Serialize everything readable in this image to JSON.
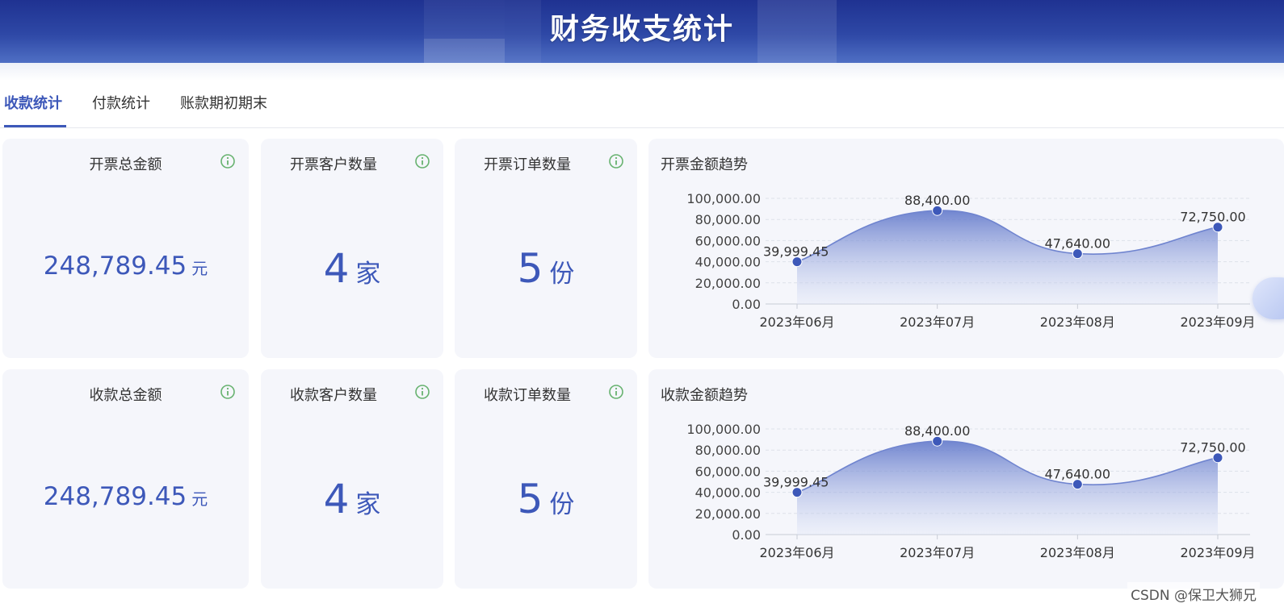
{
  "header": {
    "title": "财务收支统计"
  },
  "tabs": [
    {
      "label": "收款统计",
      "active": true
    },
    {
      "label": "付款统计",
      "active": false
    },
    {
      "label": "账款期初期末",
      "active": false
    }
  ],
  "accent_color": "#3d58b9",
  "rows": [
    {
      "stats": [
        {
          "title": "开票总金额",
          "value": "248,789.45",
          "unit": "元",
          "icon": "info-icon"
        },
        {
          "title": "开票客户数量",
          "value": "4",
          "unit": "家",
          "icon": "info-icon"
        },
        {
          "title": "开票订单数量",
          "value": "5",
          "unit": "份",
          "icon": "info-icon"
        }
      ],
      "chart_title": "开票金额趋势"
    },
    {
      "stats": [
        {
          "title": "收款总金额",
          "value": "248,789.45",
          "unit": "元",
          "icon": "info-icon"
        },
        {
          "title": "收款客户数量",
          "value": "4",
          "unit": "家",
          "icon": "info-icon"
        },
        {
          "title": "收款订单数量",
          "value": "5",
          "unit": "份",
          "icon": "info-icon"
        }
      ],
      "chart_title": "收款金额趋势"
    }
  ],
  "chart_data": [
    {
      "type": "area",
      "title": "开票金额趋势",
      "categories": [
        "2023年06月",
        "2023年07月",
        "2023年08月",
        "2023年09月"
      ],
      "values": [
        39999.45,
        88400,
        47640,
        72750
      ],
      "data_labels": [
        "39,999.45",
        "88,400.00",
        "47,640.00",
        "72,750.00"
      ],
      "y_ticks": [
        "0.00",
        "20,000.00",
        "40,000.00",
        "60,000.00",
        "80,000.00",
        "100,000.00"
      ],
      "ylim": [
        0,
        100000
      ],
      "smooth": true,
      "grid": true,
      "color": "#3d58b9"
    },
    {
      "type": "area",
      "title": "收款金额趋势",
      "categories": [
        "2023年06月",
        "2023年07月",
        "2023年08月",
        "2023年09月"
      ],
      "values": [
        39999.45,
        88400,
        47640,
        72750
      ],
      "data_labels": [
        "39,999.45",
        "88,400.00",
        "47,640.00",
        "72,750.00"
      ],
      "y_ticks": [
        "0.00",
        "20,000.00",
        "40,000.00",
        "60,000.00",
        "80,000.00",
        "100,000.00"
      ],
      "ylim": [
        0,
        100000
      ],
      "smooth": true,
      "grid": true,
      "color": "#3d58b9"
    }
  ],
  "watermark": "CSDN @保卫大狮兄"
}
